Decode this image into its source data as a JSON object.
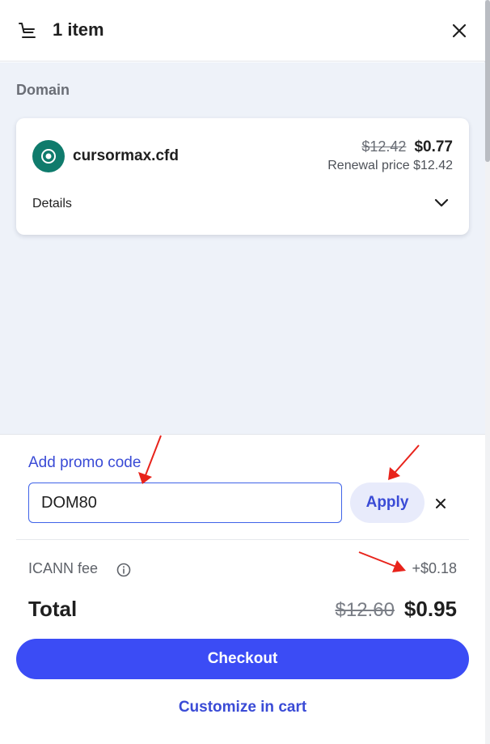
{
  "header": {
    "item_count": "1 item",
    "cart_icon": "cart-icon",
    "close_icon": "close-icon"
  },
  "content": {
    "section_label": "Domain",
    "domain_card": {
      "icon": "domain-icon",
      "name": "cursormax.cfd",
      "old_price": "$12.42",
      "new_price": "$0.77",
      "renewal": "Renewal price $12.42",
      "details_label": "Details",
      "details_icon": "chevron-down-icon"
    }
  },
  "promo": {
    "link_label": "Add promo code",
    "input_value": "DOM80",
    "apply_label": "Apply",
    "clear_icon": "close-icon"
  },
  "fees": {
    "icann_label": "ICANN fee",
    "icann_info_icon": "info-icon",
    "icann_value": "+$0.18"
  },
  "total": {
    "label": "Total",
    "old_price": "$12.60",
    "new_price": "$0.95"
  },
  "actions": {
    "checkout_label": "Checkout",
    "customize_label": "Customize in cart"
  },
  "colors": {
    "accent": "#3b4cf5",
    "link": "#3a4bd6",
    "domain_icon_bg": "#0f7b6c",
    "annotation_arrow": "#e8231b",
    "content_bg": "#eef2f9"
  }
}
